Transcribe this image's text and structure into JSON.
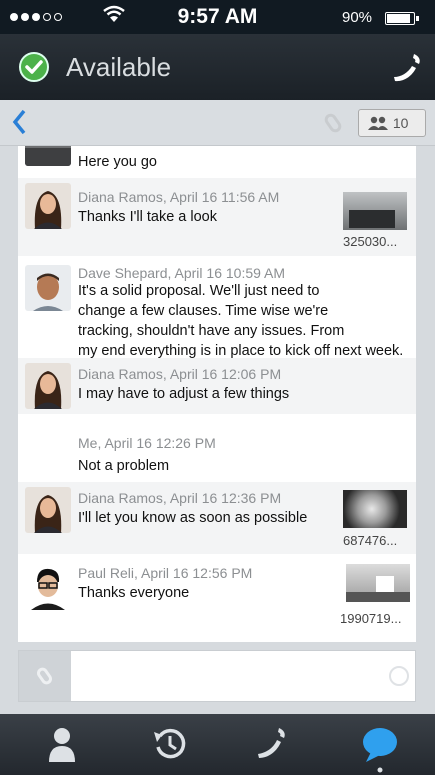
{
  "status_bar": {
    "time": "9:57 AM",
    "battery": "90%",
    "battery_level": 0.9
  },
  "header": {
    "title": "Available",
    "status_color": "#4cb24a",
    "call_icon": "phone-icon"
  },
  "nav": {
    "participants_count": "10",
    "back_icon": "chevron-left-icon"
  },
  "messages": [
    {
      "sender": "",
      "text": "Here you go"
    },
    {
      "sender": "Diana Ramos, April 16  11:56 AM",
      "text": "Thanks I'll take a look",
      "attachment": "325030..."
    },
    {
      "sender": "Dave Shepard, April 16 10:59 AM",
      "lines": [
        "It's a solid proposal.  We'll just need to",
        "change a few clauses.  Time wise we're",
        "tracking,  shouldn't have any issues.  From",
        "my end everything is in place to kick off next week."
      ]
    },
    {
      "sender": "Diana Ramos, April 16  12:06 PM",
      "text": "I may have to adjust a few things"
    },
    {
      "sender": "Me, April 16  12:26 PM",
      "text": "Not a problem"
    },
    {
      "sender": "Diana Ramos, April 16  12:36 PM",
      "text": "I'll let you know as soon as possible",
      "attachment": "687476..."
    },
    {
      "sender": "Paul Reli, April 16  12:56 PM",
      "text": "Thanks everyone",
      "attachment": "1990719..."
    }
  ],
  "tabs": [
    {
      "icon": "contacts-icon"
    },
    {
      "icon": "history-icon"
    },
    {
      "icon": "phone-icon"
    },
    {
      "icon": "chat-icon",
      "active": true
    }
  ],
  "colors": {
    "accent": "#2a7fd6",
    "header_bg": "#1b2127",
    "active_tab": "#2fa0ee"
  }
}
